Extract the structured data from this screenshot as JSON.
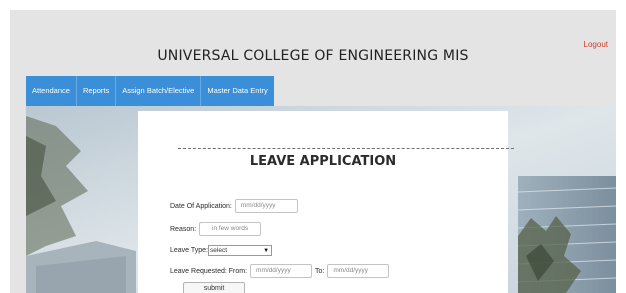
{
  "header": {
    "title": "UNIVERSAL COLLEGE OF ENGINEERING MIS",
    "logout_label": "Logout"
  },
  "nav": {
    "items": [
      {
        "label": "Attendance"
      },
      {
        "label": "Reports"
      },
      {
        "label": "Assign Batch/Elective"
      },
      {
        "label": "Master Data Entry"
      }
    ]
  },
  "form": {
    "title": "LEAVE APPLICATION",
    "date_of_application_label": "Date Of Application:",
    "date_of_application_placeholder": "mm/dd/yyyy",
    "reason_label": "Reason:",
    "reason_placeholder": "in few words",
    "leave_type_label": "Leave Type:",
    "leave_type_selected": "select",
    "leave_from_label": "Leave Requested: From:",
    "leave_from_placeholder": "mm/dd/yyyy",
    "leave_to_label": "To:",
    "leave_to_placeholder": "mm/dd/yyyy",
    "submit_label": "submit"
  },
  "colors": {
    "nav_background": "#3b8ed8",
    "logout": "#d23a2a"
  }
}
